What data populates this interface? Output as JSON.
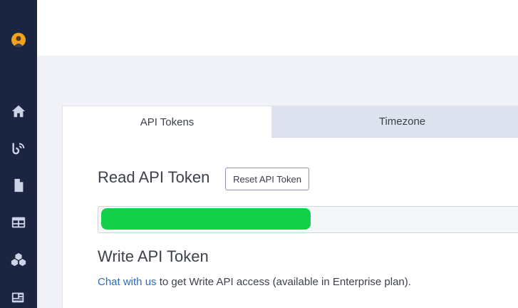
{
  "sidebar": {
    "items": [
      {
        "icon": "home-icon"
      },
      {
        "icon": "blog-icon"
      },
      {
        "icon": "document-icon"
      },
      {
        "icon": "table-icon"
      },
      {
        "icon": "cubes-icon"
      },
      {
        "icon": "media-icon"
      }
    ],
    "avatar_color": "#f2a31b"
  },
  "tabs": [
    {
      "label": "API Tokens",
      "active": true
    },
    {
      "label": "Timezone",
      "active": false
    }
  ],
  "read_section": {
    "title": "Read API Token",
    "reset_label": "Reset API Token",
    "token_mask_color": "#14cf4a"
  },
  "write_section": {
    "title": "Write API Token",
    "link_text": "Chat with us",
    "note_text": " to get Write API access (available in Enterprise plan)."
  },
  "colors": {
    "sidebar_bg": "#1b2440",
    "link": "#2f6cb3"
  }
}
